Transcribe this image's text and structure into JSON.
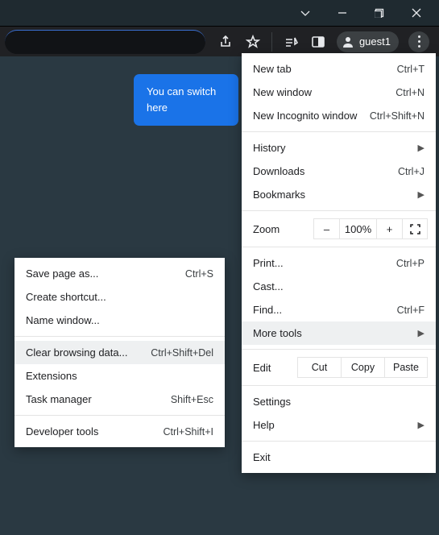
{
  "titlebar": {
    "chevron": "",
    "minimize": "",
    "maximize": "",
    "close": ""
  },
  "toolbar": {
    "share_icon": "share",
    "star_icon": "star",
    "media_icon": "media",
    "reader_icon": "reader",
    "profile_label": "guest1",
    "kebab": "menu"
  },
  "tooltip": {
    "line1": "You can switch",
    "line2": "here"
  },
  "menu": {
    "new_tab": {
      "label": "New tab",
      "accel": "Ctrl+T"
    },
    "new_window": {
      "label": "New window",
      "accel": "Ctrl+N"
    },
    "new_incog": {
      "label": "New Incognito window",
      "accel": "Ctrl+Shift+N"
    },
    "history": {
      "label": "History"
    },
    "downloads": {
      "label": "Downloads",
      "accel": "Ctrl+J"
    },
    "bookmarks": {
      "label": "Bookmarks"
    },
    "zoom": {
      "label": "Zoom",
      "minus": "–",
      "pct": "100%",
      "plus": "+"
    },
    "print": {
      "label": "Print...",
      "accel": "Ctrl+P"
    },
    "cast": {
      "label": "Cast..."
    },
    "find": {
      "label": "Find...",
      "accel": "Ctrl+F"
    },
    "more_tools": {
      "label": "More tools"
    },
    "edit": {
      "label": "Edit",
      "cut": "Cut",
      "copy": "Copy",
      "paste": "Paste"
    },
    "settings": {
      "label": "Settings"
    },
    "help": {
      "label": "Help"
    },
    "exit": {
      "label": "Exit"
    }
  },
  "submenu": {
    "save_as": {
      "label": "Save page as...",
      "accel": "Ctrl+S"
    },
    "create_shortcut": {
      "label": "Create shortcut..."
    },
    "name_window": {
      "label": "Name window..."
    },
    "clear_data": {
      "label": "Clear browsing data...",
      "accel": "Ctrl+Shift+Del"
    },
    "extensions": {
      "label": "Extensions"
    },
    "task_manager": {
      "label": "Task manager",
      "accel": "Shift+Esc"
    },
    "dev_tools": {
      "label": "Developer tools",
      "accel": "Ctrl+Shift+I"
    }
  }
}
